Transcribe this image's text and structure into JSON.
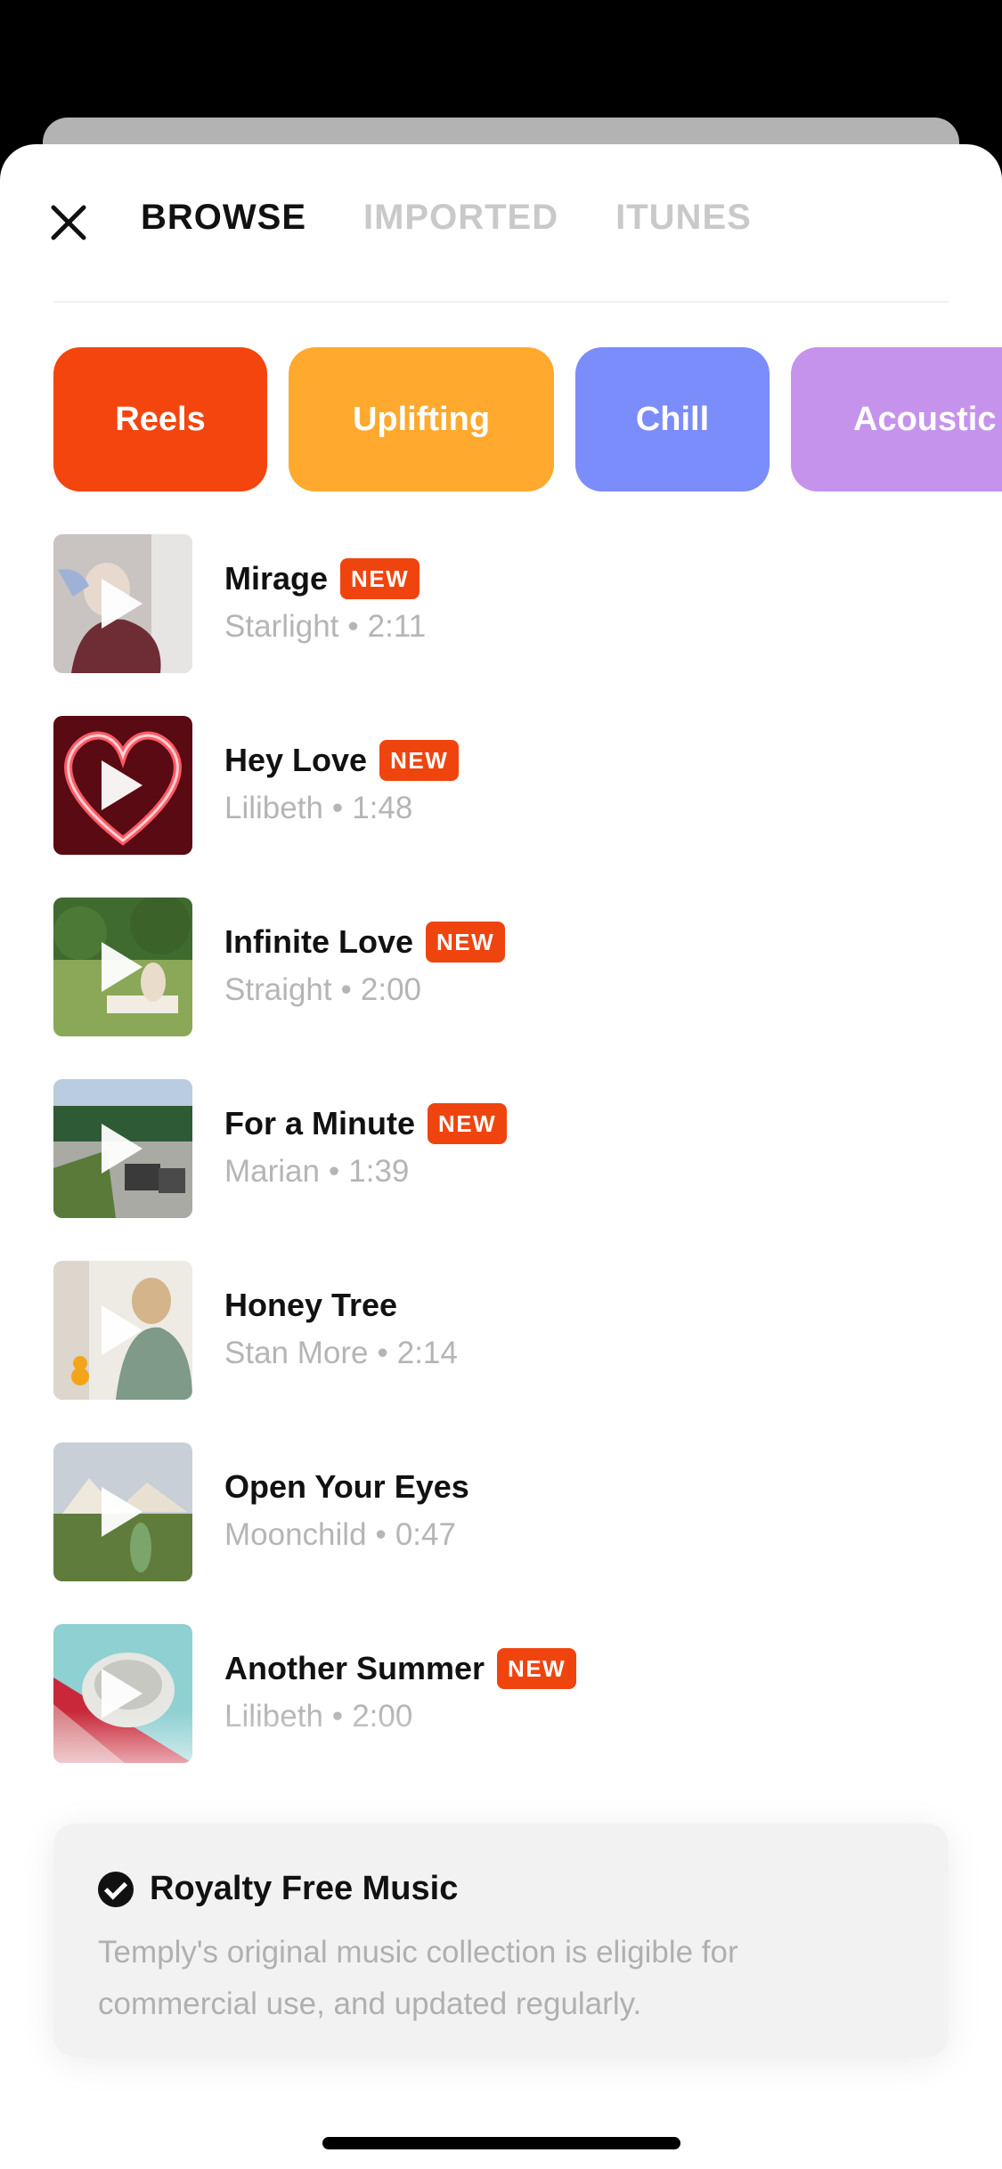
{
  "tabs": [
    {
      "label": "BROWSE",
      "active": true
    },
    {
      "label": "IMPORTED",
      "active": false
    },
    {
      "label": "ITUNES",
      "active": false
    }
  ],
  "genres": [
    {
      "label": "Reels",
      "color": "#f4450f"
    },
    {
      "label": "Uplifting",
      "color": "#ffa92e"
    },
    {
      "label": "Chill",
      "color": "#7b8cfb"
    },
    {
      "label": "Acoustic",
      "color": "#c593ec"
    }
  ],
  "tracks": [
    {
      "title": "Mirage",
      "artist": "Starlight",
      "duration": "2:11",
      "badge": "NEW",
      "thumb_icon": "portrait-photo"
    },
    {
      "title": "Hey Love",
      "artist": "Lilibeth",
      "duration": "1:48",
      "badge": "NEW",
      "thumb_icon": "neon-heart-photo"
    },
    {
      "title": "Infinite Love",
      "artist": "Straight",
      "duration": "2:00",
      "badge": "NEW",
      "thumb_icon": "park-picnic-photo"
    },
    {
      "title": "For a Minute",
      "artist": "Marian",
      "duration": "1:39",
      "badge": "NEW",
      "thumb_icon": "garden-chairs-photo"
    },
    {
      "title": "Honey Tree",
      "artist": "Stan More",
      "duration": "2:14",
      "badge": "",
      "thumb_icon": "kitchen-photo"
    },
    {
      "title": "Open Your Eyes",
      "artist": "Moonchild",
      "duration": "0:47",
      "badge": "",
      "thumb_icon": "tents-field-photo"
    },
    {
      "title": "Another Summer",
      "artist": "Lilibeth",
      "duration": "2:00",
      "badge": "NEW",
      "thumb_icon": "bowl-tablecloth-photo"
    }
  ],
  "meta_separator": "•",
  "info_card": {
    "title": "Royalty Free Music",
    "text": "Temply's original music collection is eligible for commercial use, and updated regularly."
  },
  "colors": {
    "accent": "#f0440f",
    "active_tab": "#111111",
    "inactive_tab": "#c9c9c9",
    "meta_text": "#b5b5b5"
  }
}
